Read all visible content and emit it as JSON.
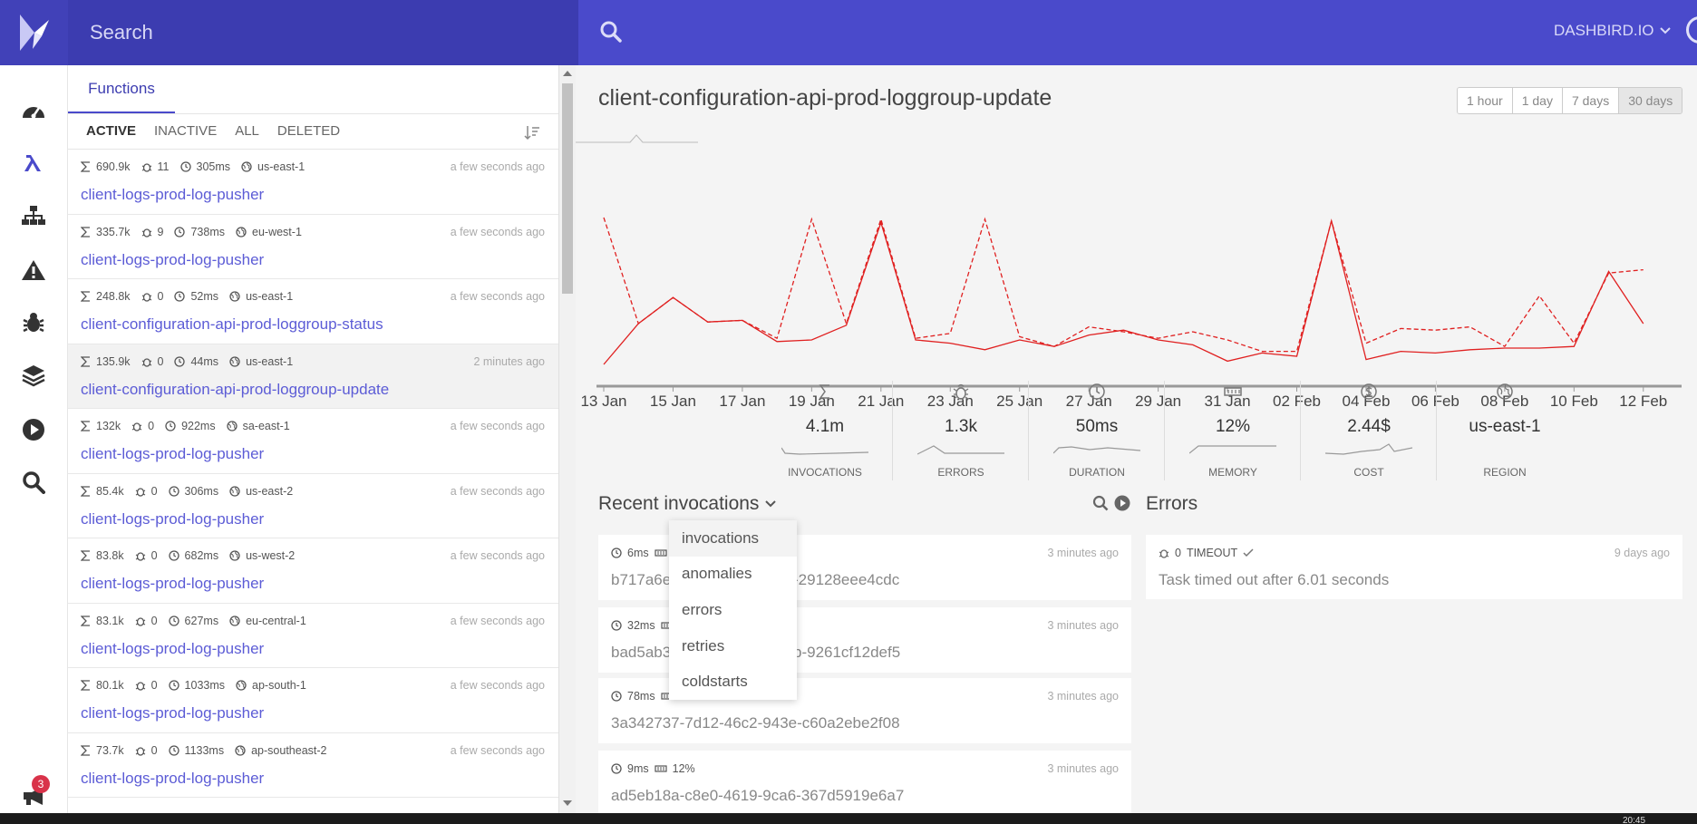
{
  "search": {
    "placeholder": "Search"
  },
  "brand": {
    "label": "DASHBIRD.IO"
  },
  "rail": {
    "notification_count": "3"
  },
  "functions_panel": {
    "tab_label": "Functions",
    "filters": [
      "ACTIVE",
      "INACTIVE",
      "ALL",
      "DELETED"
    ],
    "items": [
      {
        "invocations": "690.9k",
        "errors": "11",
        "duration": "305ms",
        "region": "us-east-1",
        "time": "a few seconds ago",
        "name": "client-logs-prod-log-pusher"
      },
      {
        "invocations": "335.7k",
        "errors": "9",
        "duration": "738ms",
        "region": "eu-west-1",
        "time": "a few seconds ago",
        "name": "client-logs-prod-log-pusher"
      },
      {
        "invocations": "248.8k",
        "errors": "0",
        "duration": "52ms",
        "region": "us-east-1",
        "time": "a few seconds ago",
        "name": "client-configuration-api-prod-loggroup-status"
      },
      {
        "invocations": "135.9k",
        "errors": "0",
        "duration": "44ms",
        "region": "us-east-1",
        "time": "2 minutes ago",
        "name": "client-configuration-api-prod-loggroup-update"
      },
      {
        "invocations": "132k",
        "errors": "0",
        "duration": "922ms",
        "region": "sa-east-1",
        "time": "a few seconds ago",
        "name": "client-logs-prod-log-pusher"
      },
      {
        "invocations": "85.4k",
        "errors": "0",
        "duration": "306ms",
        "region": "us-east-2",
        "time": "a few seconds ago",
        "name": "client-logs-prod-log-pusher"
      },
      {
        "invocations": "83.8k",
        "errors": "0",
        "duration": "682ms",
        "region": "us-west-2",
        "time": "a few seconds ago",
        "name": "client-logs-prod-log-pusher"
      },
      {
        "invocations": "83.1k",
        "errors": "0",
        "duration": "627ms",
        "region": "eu-central-1",
        "time": "a few seconds ago",
        "name": "client-logs-prod-log-pusher"
      },
      {
        "invocations": "80.1k",
        "errors": "0",
        "duration": "1033ms",
        "region": "ap-south-1",
        "time": "a few seconds ago",
        "name": "client-logs-prod-log-pusher"
      },
      {
        "invocations": "73.7k",
        "errors": "0",
        "duration": "1133ms",
        "region": "ap-southeast-2",
        "time": "a few seconds ago",
        "name": "client-logs-prod-log-pusher"
      }
    ]
  },
  "main": {
    "title": "client-configuration-api-prod-loggroup-update",
    "ranges": [
      "1 hour",
      "1 day",
      "7 days",
      "30 days"
    ],
    "selected_range": "30 days"
  },
  "chart_data": {
    "type": "line",
    "x": [
      "13 Jan",
      "14 Jan",
      "15 Jan",
      "16 Jan",
      "17 Jan",
      "18 Jan",
      "19 Jan",
      "20 Jan",
      "21 Jan",
      "22 Jan",
      "23 Jan",
      "24 Jan",
      "25 Jan",
      "26 Jan",
      "27 Jan",
      "28 Jan",
      "29 Jan",
      "30 Jan",
      "31 Jan",
      "01 Feb",
      "02 Feb",
      "03 Feb",
      "04 Feb",
      "05 Feb",
      "06 Feb",
      "07 Feb",
      "08 Feb",
      "09 Feb",
      "10 Feb",
      "11 Feb",
      "12 Feb",
      "13 Feb"
    ],
    "xticks": [
      "13 Jan",
      "15 Jan",
      "17 Jan",
      "19 Jan",
      "21 Jan",
      "23 Jan",
      "25 Jan",
      "27 Jan",
      "29 Jan",
      "31 Jan",
      "02 Feb",
      "04 Feb",
      "06 Feb",
      "08 Feb",
      "10 Feb",
      "12 Feb"
    ],
    "series": [
      {
        "style": "solid",
        "values": [
          10,
          35,
          51,
          36,
          37,
          24,
          25,
          34,
          97,
          25,
          23,
          19,
          25,
          21,
          28,
          31,
          25,
          22,
          12,
          17,
          15,
          98,
          13,
          18,
          17,
          19,
          20,
          20,
          21,
          67,
          35
        ]
      },
      {
        "style": "dashed",
        "values": [
          100,
          35,
          51,
          36,
          37,
          26,
          99,
          35,
          99,
          26,
          29,
          99,
          27,
          21,
          33,
          30,
          26,
          30,
          25,
          18,
          18,
          98,
          23,
          32,
          31,
          33,
          21,
          52,
          23,
          66,
          68
        ]
      }
    ],
    "color": "#e02020",
    "ylim": [
      0,
      110
    ],
    "grid": false,
    "legend": "none"
  },
  "stats": [
    {
      "icon": "sigma-icon",
      "value": "4.1m",
      "label": "INVOCATIONS"
    },
    {
      "icon": "bug-icon",
      "value": "1.3k",
      "label": "ERRORS"
    },
    {
      "icon": "clock-icon",
      "value": "50ms",
      "label": "DURATION"
    },
    {
      "icon": "memory-icon",
      "value": "12%",
      "label": "MEMORY"
    },
    {
      "icon": "dollar-icon",
      "value": "2.44$",
      "label": "COST"
    },
    {
      "icon": "globe-icon",
      "value": "us-east-1",
      "label": "REGION"
    }
  ],
  "invocations": {
    "title": "Recent invocations",
    "items": [
      {
        "duration": "6ms",
        "memory": "",
        "time": "3 minutes ago",
        "id_left": "b717a6e",
        "id_right": "-29128eee4cdc"
      },
      {
        "duration": "32ms",
        "memory": "",
        "time": "3 minutes ago",
        "id_left": "bad5ab3",
        "id_right": "b-9261cf12def5"
      },
      {
        "duration": "78ms",
        "memory": "",
        "time": "3 minutes ago",
        "id_left": "3a342737-7d12-46c2-943e-c60a2ebe2f08",
        "id_right": ""
      },
      {
        "duration": "9ms",
        "memory": "12%",
        "time": "3 minutes ago",
        "id_left": "ad5eb18a-c8e0-4619-9ca6-367d5919e6a7",
        "id_right": ""
      }
    ],
    "dropdown": [
      "invocations",
      "anomalies",
      "errors",
      "retries",
      "coldstarts"
    ],
    "dropdown_selected": "invocations"
  },
  "errors": {
    "title": "Errors",
    "items": [
      {
        "count": "0",
        "type": "TIMEOUT",
        "time": "9 days ago",
        "message": "Task timed out after 6.01 seconds"
      }
    ]
  },
  "taskbar": {
    "clock": "20:45"
  }
}
